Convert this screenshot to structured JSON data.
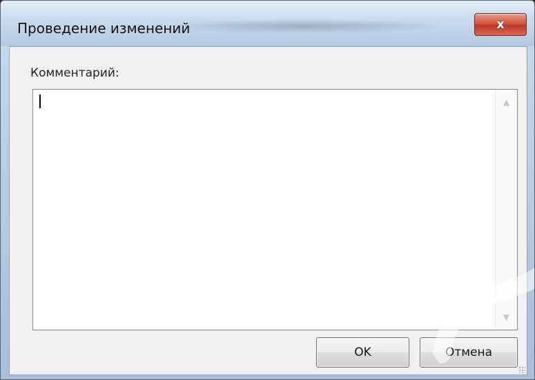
{
  "window": {
    "title": "Проведение изменений",
    "close_glyph": "x"
  },
  "form": {
    "comment_label": "Комментарий:",
    "comment_value": "",
    "scroll_up_glyph": "▲",
    "scroll_down_glyph": "▼"
  },
  "buttons": {
    "ok_label": "OK",
    "cancel_label": "Отмена"
  },
  "icons": {
    "close": "close-icon",
    "scroll_up": "scroll-up-arrow-icon",
    "scroll_down": "scroll-down-arrow-icon",
    "resize": "resize-grip-icon"
  },
  "colors": {
    "close_button": "#c0392a",
    "title_bar": "#cadcee",
    "client_background": "#f0f0f0"
  }
}
